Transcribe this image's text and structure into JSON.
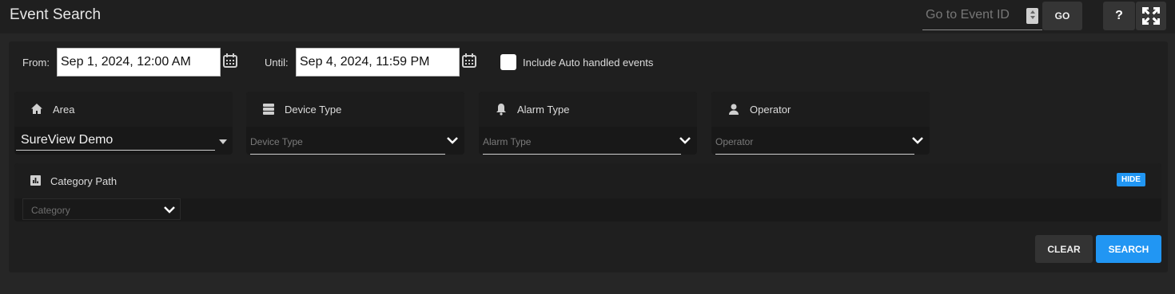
{
  "header": {
    "title": "Event Search",
    "goto_placeholder": "Go to Event ID",
    "go_label": "GO",
    "help_label": "?"
  },
  "dates": {
    "from_label": "From:",
    "from_value": "Sep 1, 2024, 12:00 AM",
    "until_label": "Until:",
    "until_value": "Sep 4, 2024, 11:59 PM"
  },
  "auto_handled": {
    "label": "Include Auto handled events",
    "checked": false
  },
  "filters": {
    "area": {
      "title": "Area",
      "value": "SureView Demo"
    },
    "device_type": {
      "title": "Device Type",
      "placeholder": "Device Type"
    },
    "alarm_type": {
      "title": "Alarm Type",
      "placeholder": "Alarm Type"
    },
    "operator": {
      "title": "Operator",
      "placeholder": "Operator"
    }
  },
  "category": {
    "title": "Category Path",
    "hide_label": "HIDE",
    "placeholder": "Category"
  },
  "actions": {
    "clear_label": "CLEAR",
    "search_label": "SEARCH"
  },
  "colors": {
    "accent": "#2196f3",
    "background": "#262626",
    "panel": "#1f1f1f"
  }
}
